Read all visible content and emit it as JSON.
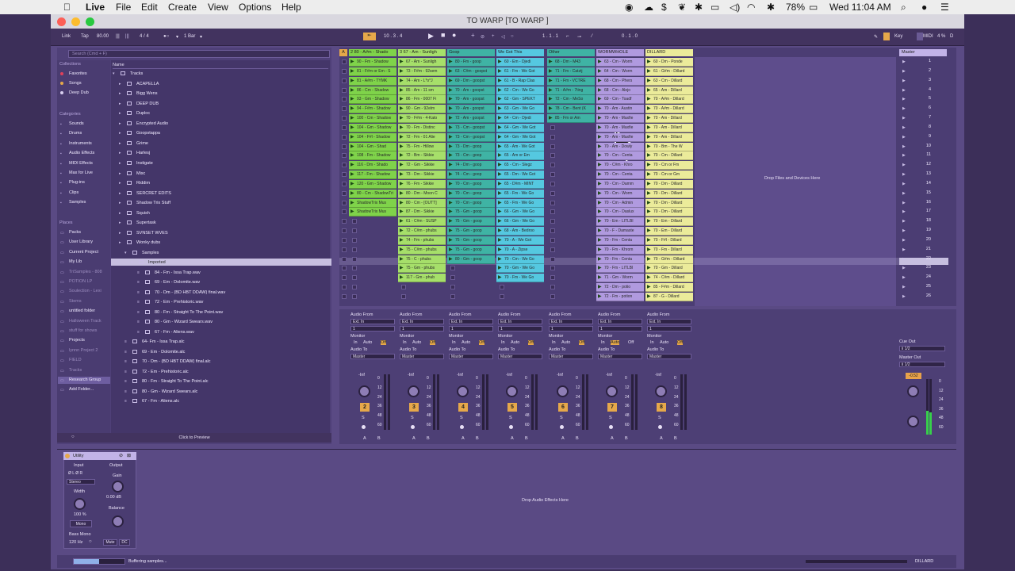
{
  "menubar": {
    "items": [
      "Live",
      "File",
      "Edit",
      "Create",
      "View",
      "Options",
      "Help"
    ],
    "battery": "78%",
    "clock": "Wed 11:04 AM"
  },
  "window": {
    "title": "TO WARP  [TO WARP ]"
  },
  "control": {
    "link": "Link",
    "tap": "Tap",
    "tempo": "80.00",
    "sig": "4 / 4",
    "bar": "1 Bar",
    "pos": "10 .  3 .  4",
    "pos2": "1 .  1 .  1",
    "pos3": "0 .  1 .  0",
    "key": "Key",
    "midi": "MIDI",
    "cpu": "4 %",
    "d": "D"
  },
  "browser": {
    "search": "Search (Cmd + F)",
    "collections_h": "Collections",
    "collections": [
      "Favorites",
      "Songs",
      "Deep Dub"
    ],
    "categories_h": "Categories",
    "categories": [
      "Sounds",
      "Drums",
      "Instruments",
      "Audio Effects",
      "MIDI Effects",
      "Max for Live",
      "Plug-ins",
      "Clips",
      "Samples"
    ],
    "places_h": "Places",
    "places": [
      "Packs",
      "User Library",
      "Current Project",
      "My Lib",
      "TriSamples - 808",
      "POTION LP",
      "Soulection - Lexi",
      "Stems",
      "untitled folder",
      "Halloween Track",
      "stuff for shows",
      "Projects",
      "lynnn Project 2",
      "FIELD",
      "Tracks",
      "Research Group",
      "Add Folder..."
    ],
    "name_h": "Name",
    "tree": [
      "Tracks",
      "ACAPELLA",
      "Bigg Wens",
      "DEEP DUB",
      "Duploc",
      "Encrypted Audio",
      "Goopstappa",
      "Grime",
      "Harlesj",
      "Instigate",
      "Misc",
      "Riddim",
      "SERCRET EDITS",
      "Shadow Trix Stuff",
      "Squish",
      "Supertask",
      "SVNSET WVES",
      "Wonky dubs",
      "Samples",
      "Imported",
      "84 - Fm - Issa Trap.wav",
      "69 - Em - Dolomite.wav",
      "70 - Dm - (BD HBT DDAW) final.wav",
      "72 - Em - Prehistoric.wav",
      "80 - Fm - Straight To The Point.wav",
      "80 - Gm - Wizard Swears.wav",
      "67 - Fm - Aliens.wav",
      "64- Fm - Issa Trap.alc",
      "69 - Em - Dolomite.alc",
      "70 - Dm - (BD HBT DDAW) final.alc",
      "72 - Em - Prehistoric.alc",
      "80 - Fm - Straight To The Point.alc",
      "80 - Gm - Wizard Swears.alc",
      "67 - Fm - Aliens.alc"
    ],
    "preview": "Click to Preview"
  },
  "session": {
    "tracks": [
      {
        "name": "2 80 - A#m - Shado",
        "color": "#7fd34a",
        "num": "2",
        "clips": [
          "90 - Fm - Shadow",
          "81 - F#m or Em - S",
          "81 - A#m - TYMK",
          "86 - Cm - Shadow",
          "93 - Gm - Shadow",
          "94 - F#m - Shadow",
          "100 - Cm - Shadow",
          "104 - Gm - Shadow",
          "104 - F#l - Shadow",
          "104 - Gm - Shad",
          "108 - Fm - Shadow",
          "116 - Dm - Shado",
          "117 - Fm - Shadow",
          "120 - Gm - Shadow",
          "80 - Cm - ShadowTri",
          "ShadowTrix Mus",
          "ShadowTrix Mus"
        ]
      },
      {
        "name": "3 67 - Am - Sunligh",
        "color": "#a6df6a",
        "num": "3",
        "clips": [
          "67 - Am - Sunligh",
          "73 - F#m - 92sem",
          "74 - Am - L*o*J",
          "85 - Am - 11 sm",
          "86 - Fm - 0007 Fi",
          "90 - Gm - 92elm",
          "70 - F#m - 4-Kato",
          "70 - Fm - Distinc",
          "72 - Fm - 01 Alie",
          "75 - Fm - Hillow",
          "72 - Bm - Sikkie",
          "72 - Gm - Sikkie",
          "73 - Dm - Sikkie",
          "76 - Fm - Sikkie",
          "80 - Dm - Moon C",
          "80 - Cm - [OUTT]",
          "87 - Dm - Sikkie",
          "61 - C#m - SUSP",
          "72 - C#m - phubs",
          "74 - Fm - phubs",
          "75 - C#m - phubs",
          "75 - C - phubs",
          "75 - Gm - phubs",
          "117 - Gm - phub"
        ]
      },
      {
        "name": "Goop",
        "color": "#3fb3a4",
        "num": "4",
        "clips": [
          "80 - Fm - goop",
          "63 - C#m - goopst",
          "69 - Dm - goopst",
          "70 - Am - goopst",
          "70 - Am - goopst",
          "70 - Am - goopst",
          "72 - Am - goopst",
          "73 - Cm - goopst",
          "73 - Cm - goopst",
          "73 - Dm - goop",
          "73 - Cm - goop",
          "74 - Dm - goop",
          "74 - Cm - goop",
          "70 - Cm - goop",
          "70 - Cm - goop",
          "70 - Cm - goop",
          "75 - Gm - goop",
          "75 - Gm - goop",
          "75 - Gm - goop",
          "75 - Gm - goop",
          "75 - Gm - goop",
          "80 - Gm - goop"
        ]
      },
      {
        "name": "We Got This",
        "color": "#55c8e0",
        "num": "5",
        "clips": [
          "60 - Em - Djedi",
          "61 - Fm - We Got",
          "61 - B - Rap Clas",
          "62 - Cm - We Go",
          "62 - Gm - SPEKT",
          "63 - Gm - We Go",
          "64 - Cm - Djedi",
          "64 - Gm - We Got",
          "64 - Gm - We Got",
          "65 - Am - We Got",
          "65 - Am or Em",
          "65 - Cm - Slegz",
          "65 - Dm - We Got",
          "65 - D#m - MINT",
          "65 - Fm - We Go",
          "65 - Fm - We Go",
          "66 - Gm - We Go",
          "66 - Gm - We Go",
          "68 - Am - Bedroo",
          "70 - A - We Got",
          "70 - A - Zipse",
          "70 - Cm - We Go",
          "70 - Gm - We Go",
          "70 - Fm - We Go"
        ]
      },
      {
        "name": "Other",
        "color": "#3fb3a4",
        "num": "6",
        "clips": [
          "68 - Dm - M43",
          "71 - Fm - Catztj",
          "71 - Fm - VCTRE",
          "71 - A#m - 7ting",
          "72 - Cm - MeSo",
          "78 - Cm - Bent (K",
          "85 - Fm or Am"
        ]
      },
      {
        "name": "WORMWHOLE",
        "color": "#b09adf",
        "num": "7",
        "clips": [
          "63 - Cm - Worm",
          "64 - Cm - Worm",
          "68 - Cm - Phers",
          "68 - Cm - Alejo",
          "69 - Cm - Toadf",
          "70 - Am - Austin",
          "70 - Am - Maxfie",
          "70 - Am - Maxfie",
          "70 - Am - Maxfie",
          "70 - Am - Dowly",
          "70 - Cm - Centa",
          "70 - C#m - Khro",
          "70 - Cm - Centa",
          "70 - Cm - Damm",
          "70 - Cm - Worm",
          "70 - Cm - Admin",
          "70 - Cm - Daslux",
          "70 - Em - LITLBI",
          "70 - F - Damaste",
          "70 - Fm - Centa",
          "70 - Fm - Khrom",
          "70 - Fm - Centa",
          "70 - Fm - LITLBI",
          "71 - Gm - Worm",
          "72 - Dm - potio",
          "72 - Fm - potion"
        ]
      },
      {
        "name": "DILLARD",
        "color": "#ebeb9a",
        "num": "8",
        "clips": [
          "60 - Dm - Ponde",
          "61 - G#m - Dillard",
          "63 - Cm - Dillard",
          "65 - Am - Dillard",
          "70 - A#m - Dillard",
          "70 - A#m - Dillard",
          "70 - Am - Dillard",
          "70 - Am - Dillard",
          "70 - Am - Dillard",
          "70 - Bm - The W",
          "70 - Cm - Dillard",
          "70 - Cm or Fm",
          "70 - Cm or Gm",
          "70 - Dm - Dillard",
          "70 - Dm - Dillard",
          "70 - Dm - Dillard",
          "70 - Dm - Dillard",
          "70 - Em - Dillard",
          "70 - Em - Dillard",
          "70 - F#l - Dillard",
          "70 - Fm - Dillard",
          "70 - G#m - Dillard",
          "70 - Gm - Dillard",
          "74 - C#m - Dillard",
          "85 - F#m - Dillard",
          "87 - G - Dillard"
        ]
      }
    ],
    "drop_label": "Drop Files and Devices Here",
    "master_label": "Master",
    "scenes": [
      "1",
      "2",
      "3",
      "4",
      "5",
      "6",
      "7",
      "8",
      "9",
      "10",
      "11",
      "12",
      "13",
      "14",
      "15",
      "16",
      "17",
      "18",
      "19",
      "20",
      "21",
      "22",
      "23",
      "24",
      "25",
      "26"
    ],
    "io": {
      "audio_from": "Audio From",
      "ext_in": "Ext. In",
      "one": "1",
      "monitor": "Monitor",
      "in": "In",
      "auto": "Auto",
      "off": "Off",
      "audio_to": "Audio To",
      "master": "Master",
      "inf": "-Inf",
      "a": "A",
      "b": "B",
      "s": "S"
    },
    "cue_out": "Cue Out",
    "cue_val": "ii 1/2",
    "master_out": "Master Out",
    "master_val": "ii 1/2",
    "db_vals": [
      "0",
      "12",
      "24",
      "36",
      "48",
      "60"
    ]
  },
  "device": {
    "name": "Utility",
    "input": "Input",
    "output": "Output",
    "stereo": "Stereo",
    "width": "Width",
    "width_val": "100 %",
    "mono": "Mono",
    "gain": "Gain",
    "gain_val": "0.00 dB",
    "balance": "Balance",
    "bass_mono": "Bass Mono",
    "hz": "120 Hz",
    "mute": "Mute",
    "dc": "DC",
    "drop": "Drop Audio Effects Here"
  },
  "status": {
    "text": "Buffering samples...",
    "progress": 0.5,
    "track": "DILLARD"
  }
}
